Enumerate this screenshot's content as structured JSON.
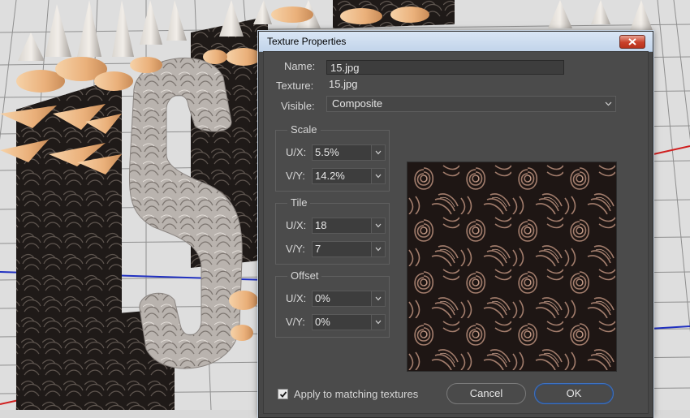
{
  "dialog": {
    "title": "Texture Properties",
    "close_icon": "close-x-icon",
    "name_label": "Name:",
    "name_value": "15.jpg",
    "texture_label": "Texture:",
    "texture_value": "15.jpg",
    "visible_label": "Visible:",
    "visible_value": "Composite",
    "scale": {
      "title": "Scale",
      "ux_label": "U/X:",
      "ux_value": "5.5%",
      "vy_label": "V/Y:",
      "vy_value": "14.2%"
    },
    "tile": {
      "title": "Tile",
      "ux_label": "U/X:",
      "ux_value": "18",
      "vy_label": "V/Y:",
      "vy_value": "7"
    },
    "offset": {
      "title": "Offset",
      "ux_label": "U/X:",
      "ux_value": "0%",
      "vy_label": "V/Y:",
      "vy_value": "0%"
    },
    "apply_label": "Apply to matching textures",
    "apply_checked": true,
    "cancel_label": "Cancel",
    "ok_label": "OK"
  },
  "colors": {
    "dialog_bg": "#4b4b4b",
    "titlebar": "#c8d8ec",
    "ok_border": "#3e71c1",
    "spike": "#f0bf8c",
    "floor_axis_blue": "#2030c0",
    "floor_axis_red": "#d02020"
  }
}
